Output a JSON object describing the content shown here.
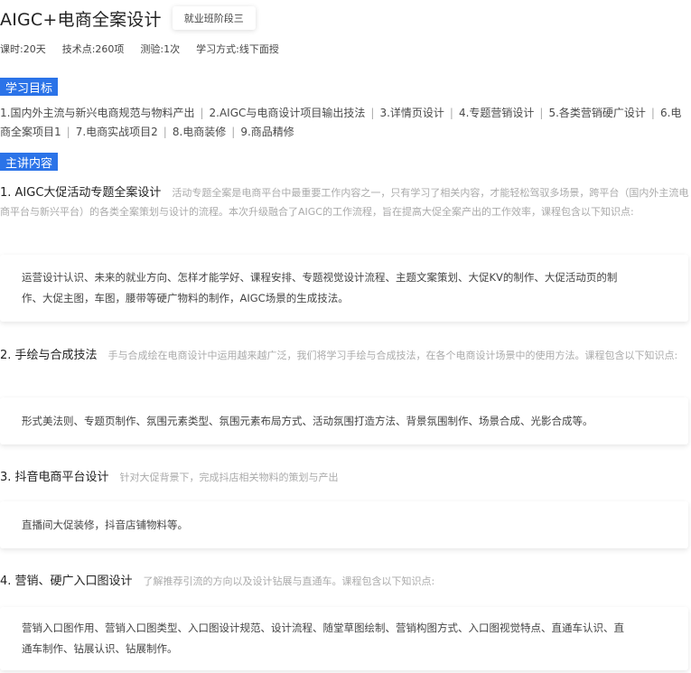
{
  "header": {
    "title": "AIGC+电商全案设计",
    "stage_badge": "就业班阶段三"
  },
  "meta": {
    "hours": "课时:20天",
    "points": "技术点:260项",
    "tests": "测验:1次",
    "mode": "学习方式:线下面授"
  },
  "goals": {
    "tag": "学习目标",
    "items": [
      "1.国内外主流与新兴电商规范与物料产出",
      "2.AIGC与电商设计项目输出技法",
      "3.详情页设计",
      "4.专题营销设计",
      "5.各类营销硬广设计",
      "6.电商全案项目1",
      "7.电商实战项目2",
      "8.电商装修",
      "9.商品精修"
    ]
  },
  "content": {
    "tag": "主讲内容",
    "topics": [
      {
        "title": "1. AIGC大促活动专题全案设计",
        "desc": "活动专题全案是电商平台中最重要工作内容之一，只有学习了相关内容，才能轻松驾驭多场景，跨平台（国内外主流电商平台与新兴平台）的各类全案策划与设计的流程。本次升级融合了AIGC的工作流程，旨在提高大促全案产出的工作效率，课程包含以下知识点:",
        "points": "运营设计认识、未来的就业方向、怎样才能学好、课程安排、专题视觉设计流程、主题文案策划、大促KV的制作、大促活动页的制作、大促主图，车图，腰带等硬广物料的制作，AIGC场景的生成技法。"
      },
      {
        "title": "2. 手绘与合成技法",
        "desc": "手与合成绘在电商设计中运用越来越广泛，我们将学习手绘与合成技法，在各个电商设计场景中的使用方法。课程包含以下知识点:",
        "points": "形式美法则、专题页制作、氛围元素类型、氛围元素布局方式、活动氛围打造方法、背景氛围制作、场景合成、光影合成等。"
      },
      {
        "title": "3. 抖音电商平台设计",
        "desc": "针对大促背景下，完成抖店相关物料的策划与产出",
        "points": "直播间大促装修，抖音店铺物料等。"
      },
      {
        "title": "4. 营销、硬广入口图设计",
        "desc": "了解推荐引流的方向以及设计钻展与直通车。课程包含以下知识点:",
        "points": "营销入口图作用、营销入口图类型、入口图设计规范、设计流程、随堂草图绘制、营销构图方式、入口图视觉特点、直通车认识、直通车制作、钻展认识、钻展制作。"
      }
    ]
  }
}
